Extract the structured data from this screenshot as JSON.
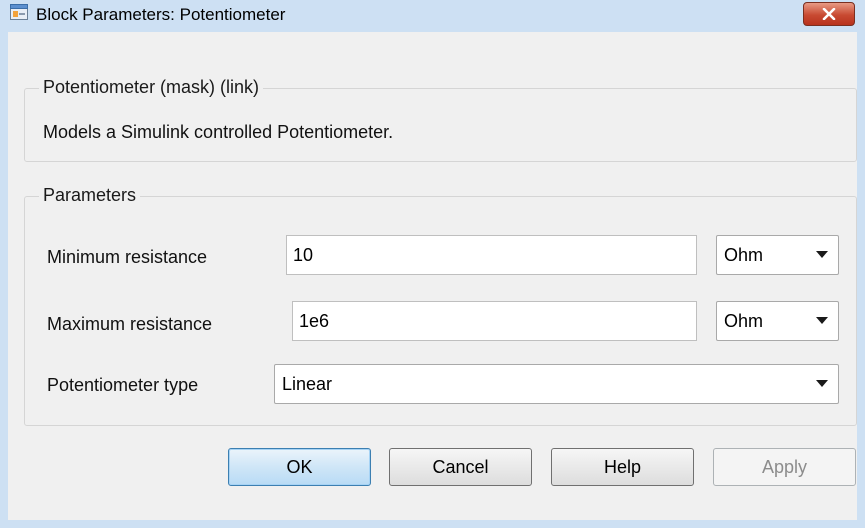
{
  "window": {
    "title": "Block Parameters: Potentiometer"
  },
  "mask_group": {
    "title": "Potentiometer (mask) (link)",
    "description": "Models a Simulink controlled Potentiometer."
  },
  "parameters": {
    "title": "Parameters",
    "min_resistance": {
      "label": "Minimum resistance",
      "value": "10",
      "unit": "Ohm"
    },
    "max_resistance": {
      "label": "Maximum resistance",
      "value": "1e6",
      "unit": "Ohm"
    },
    "pot_type": {
      "label": "Potentiometer type",
      "value": "Linear"
    }
  },
  "buttons": {
    "ok": "OK",
    "cancel": "Cancel",
    "help": "Help",
    "apply": "Apply"
  },
  "colors": {
    "title_bar": "#cde0f3",
    "dialog_background": "#f0f0f0",
    "close_button": "#c84a32",
    "default_button_border": "#3c7fb1"
  }
}
